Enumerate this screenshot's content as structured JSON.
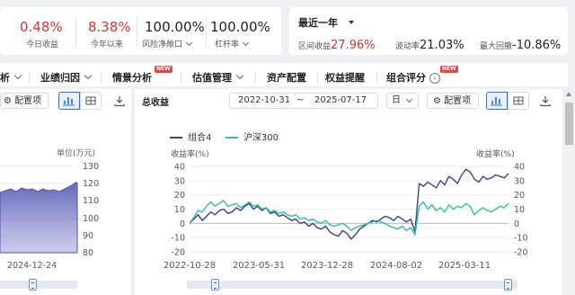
{
  "stats": [
    {
      "value": "0.48%",
      "label": "今日收益",
      "color": "#e0312f"
    },
    {
      "value": "8.38%",
      "label": "今年以来",
      "color": "#e0312f"
    },
    {
      "value": "100.00%",
      "label": "风险净敞口",
      "color": "#222222"
    },
    {
      "value": "100.00%",
      "label": "杠杆率",
      "color": "#222222"
    }
  ],
  "period": {
    "title": "最近一年",
    "return_label": "区间收益",
    "return_value": "27.96%",
    "volatility_label": "波动率",
    "volatility_value": "21.03%",
    "drawdown_label": "最大回撤",
    "drawdown_value": "-10.86%"
  },
  "nav": {
    "items": [
      {
        "label": "析",
        "chevron": true,
        "badge": ""
      },
      {
        "label": "业绩归因",
        "chevron": true,
        "badge": ""
      },
      {
        "label": "情景分析",
        "chevron": false,
        "badge": "NEW"
      },
      {
        "label": "估值管理",
        "chevron": true,
        "badge": ""
      },
      {
        "label": "资产配置",
        "chevron": false,
        "badge": ""
      },
      {
        "label": "权益提醒",
        "chevron": false,
        "badge": ""
      },
      {
        "label": "组合评分",
        "chevron": false,
        "badge": "NEW",
        "info": true
      }
    ]
  },
  "toolbar": {
    "config_label": "配置项",
    "section_title": "总收益",
    "date_start": "2022-10-31",
    "date_sep": "~",
    "date_end": "2025-07-17",
    "frequency": "日"
  },
  "left_chart": {
    "unit_label": "单位(万元)",
    "y_ticks": [
      "130",
      "120",
      "110",
      "100",
      "90",
      "80"
    ],
    "x_label": "2024-12-24",
    "fill_color": "#5b5fb5"
  },
  "chart_data": {
    "type": "line",
    "x_ticks": [
      "2022-10-28",
      "2023-05-31",
      "2023-12-28",
      "2024-08-02",
      "2025-03-11"
    ],
    "y_left_label": "收益率(%)",
    "y_right_label": "收益率(%)",
    "y_ticks": [
      40,
      30,
      20,
      10,
      0,
      -10,
      -20
    ],
    "ylim": [
      -20,
      40
    ],
    "legend_position": "top-left",
    "series": [
      {
        "name": "组合4",
        "color": "#3b3f8f",
        "values": [
          0,
          3,
          6,
          2,
          5,
          8,
          6,
          9,
          10,
          7,
          8,
          11,
          9,
          12,
          14,
          10,
          12,
          9,
          11,
          7,
          8,
          5,
          6,
          4,
          2,
          3,
          0,
          1,
          -2,
          0,
          -3,
          -4,
          -2,
          -6,
          -8,
          -9,
          -5,
          -7,
          -11,
          -8,
          -4,
          -2,
          0,
          2,
          1,
          3,
          5,
          4,
          2,
          5,
          3,
          1,
          3,
          -6,
          28,
          26,
          29,
          27,
          25,
          30,
          27,
          33,
          31,
          28,
          34,
          38,
          36,
          31,
          29,
          33,
          31,
          32,
          34,
          33,
          32,
          35
        ]
      },
      {
        "name": "沪深300",
        "color": "#2ebfa5",
        "values": [
          0,
          4,
          9,
          8,
          12,
          15,
          12,
          14,
          16,
          12,
          13,
          14,
          11,
          13,
          15,
          12,
          13,
          10,
          11,
          8,
          9,
          7,
          8,
          6,
          5,
          6,
          3,
          4,
          2,
          3,
          1,
          0,
          2,
          -1,
          -2,
          -1,
          0,
          -2,
          -5,
          -3,
          -2,
          -1,
          0,
          1,
          2,
          1,
          0,
          -2,
          -3,
          -4,
          -2,
          -5,
          -3,
          -8,
          12,
          15,
          10,
          13,
          9,
          11,
          8,
          13,
          10,
          12,
          11,
          14,
          12,
          6,
          9,
          11,
          9,
          8,
          10,
          12,
          11,
          14
        ]
      }
    ]
  }
}
